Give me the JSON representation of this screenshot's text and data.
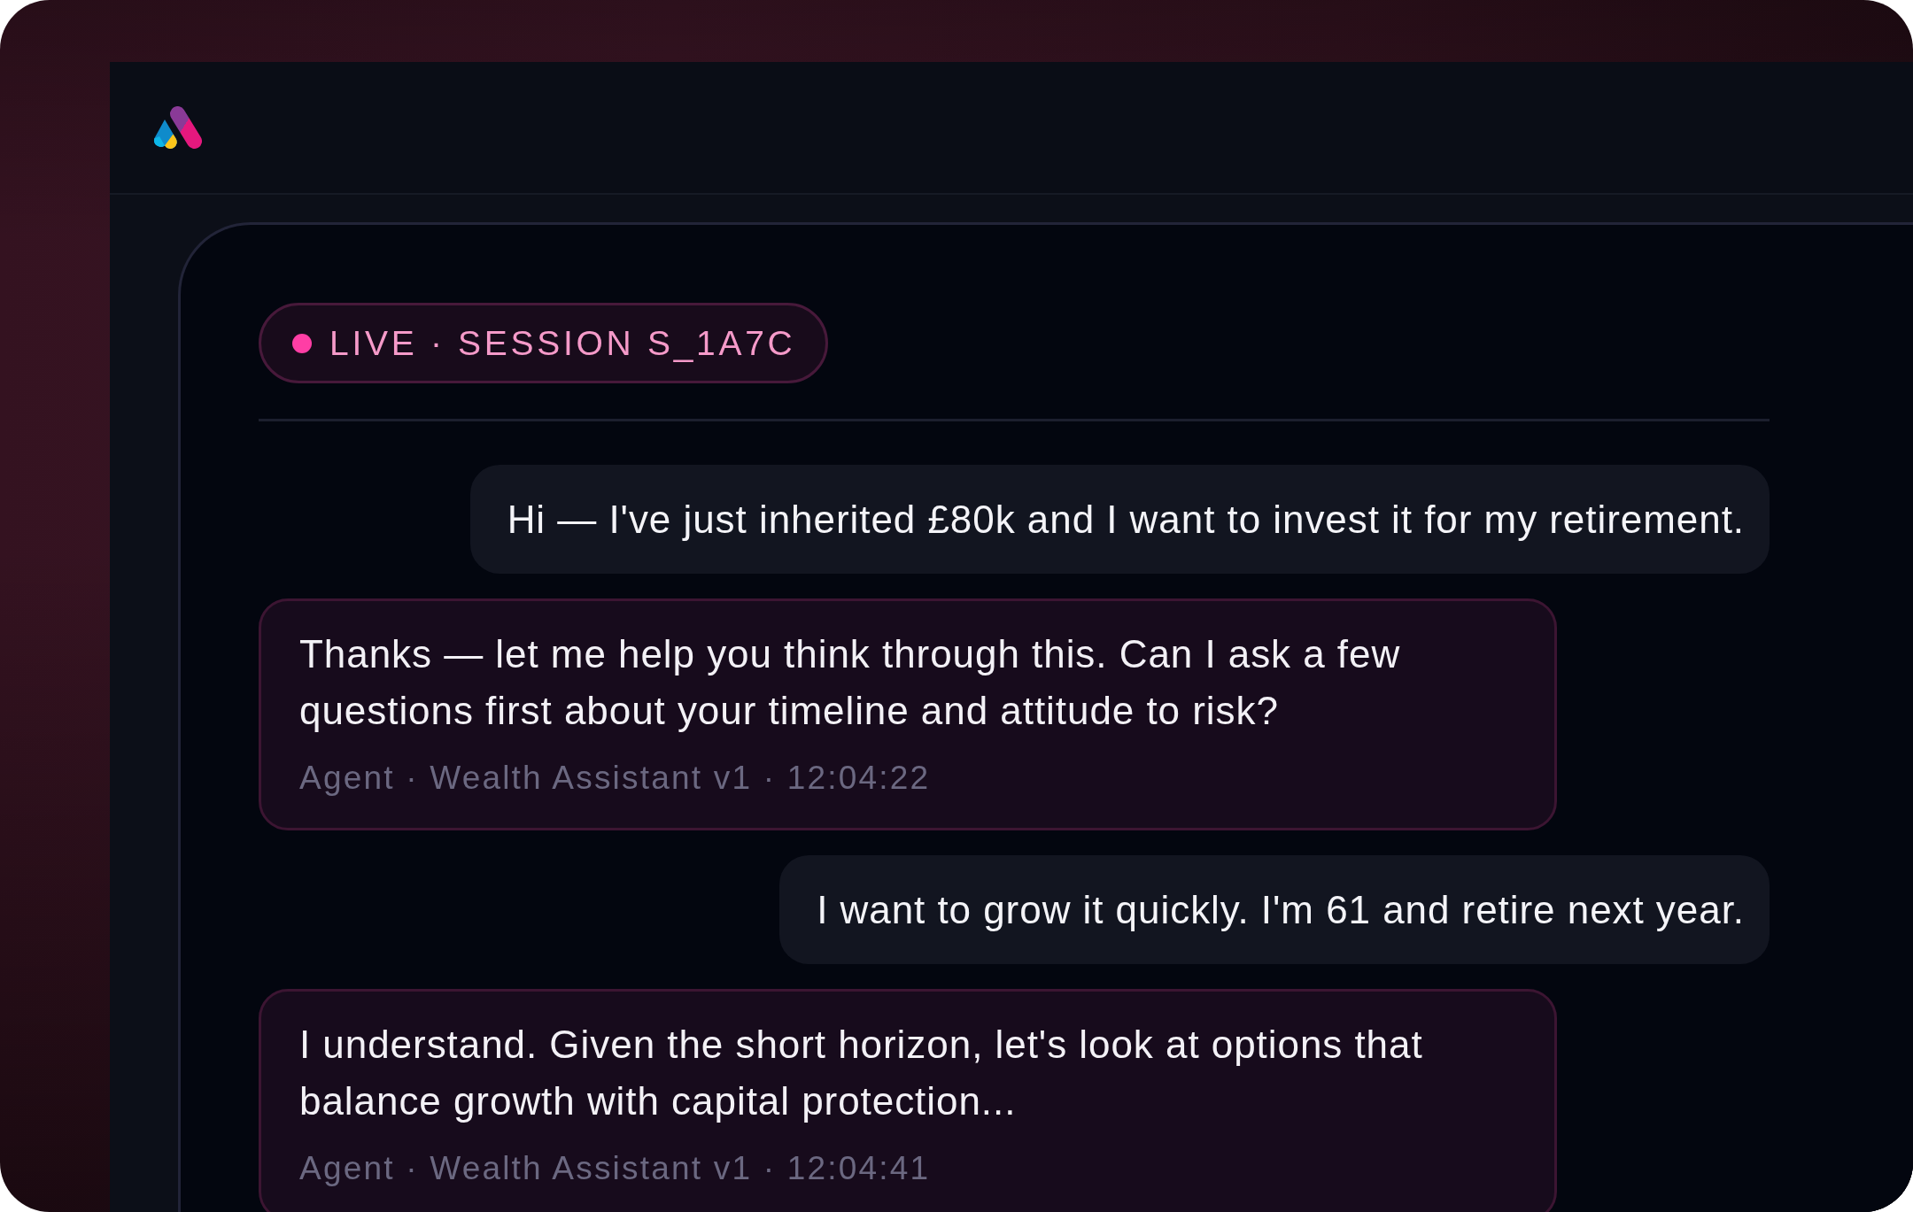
{
  "session": {
    "live": true,
    "label": "LIVE · SESSION S_1A7C"
  },
  "messages": [
    {
      "kind": "user",
      "text": "Hi — I've just inherited £80k and I want to invest it for my retirement."
    },
    {
      "kind": "agent",
      "text": "Thanks — let me help you think through this. Can I ask a few questions first about your timeline and attitude to risk?",
      "meta": "Agent · Wealth Assistant v1 · 12:04:22"
    },
    {
      "kind": "user",
      "text": "I want to grow it quickly. I'm 61 and retire next year."
    },
    {
      "kind": "agent",
      "text": "I understand. Given the short horizon, let's look at options that balance growth with capital protection...",
      "meta": "Agent · Wealth Assistant v1 · 12:04:41"
    }
  ]
}
